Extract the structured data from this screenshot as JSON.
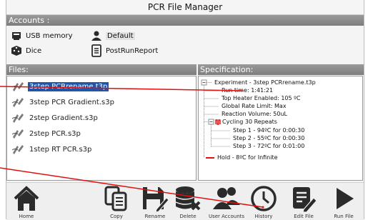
{
  "window": {
    "title": "PCR File Manager"
  },
  "accounts": {
    "header": "Accounts :",
    "items": [
      {
        "label": "USB memory",
        "icon": "usb-drive-icon"
      },
      {
        "label": "Default",
        "icon": "user-icon"
      },
      {
        "label": "Dice",
        "icon": "dice-icon"
      },
      {
        "label": "PostRunReport",
        "icon": "report-icon"
      }
    ]
  },
  "files": {
    "header": "Files:",
    "items": [
      {
        "label": "3step PCRrename.t3p",
        "selected": true
      },
      {
        "label": "3step PCR Gradient.s3p",
        "selected": false
      },
      {
        "label": "2step Gradient.s3p",
        "selected": false
      },
      {
        "label": "2step PCR.s3p",
        "selected": false
      },
      {
        "label": "1step RT PCR.s3p",
        "selected": false
      }
    ]
  },
  "spec": {
    "header": "Specification:",
    "experiment": "Experiment - 3step PCRrename.t3p",
    "run_time": "Run time: 1:41:21",
    "top_heater": "Top Heater Enabled: 105 ºC",
    "rate_limit": "Global Rate Limit: Max",
    "reaction_volume": "Reaction Volume: 50uL",
    "cycling": "Cycling 30 Repeats",
    "step1": "Step 1 - 94ºC for 0:00:30",
    "step2": "Step 2 - 55ºC for 0:00:30",
    "step3": "Step 3 - 72ºC for 0:01:00",
    "hold": "Hold - 8ºC for Infinite"
  },
  "toolbar": {
    "home": "Home",
    "copy": "Copy",
    "rename": "Rename",
    "delete": "Delete",
    "user_accounts": "User Accounts",
    "history": "History",
    "edit_file": "Edit File",
    "run_file": "Run File"
  },
  "colors": {
    "selection": "#1f56a8",
    "annotation": "#e01010",
    "icon": "#2b2b2b"
  }
}
